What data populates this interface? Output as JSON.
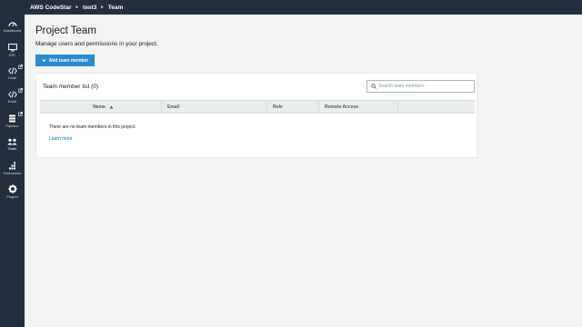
{
  "breadcrumb": {
    "service": "AWS CodeStar",
    "project": "test3",
    "page": "Team"
  },
  "sidebar": {
    "items": [
      {
        "label": "Dashboard",
        "icon": "dashboard-icon"
      },
      {
        "label": "IDE",
        "icon": "monitor-icon"
      },
      {
        "label": "Code",
        "icon": "code-icon"
      },
      {
        "label": "Build",
        "icon": "code-icon"
      },
      {
        "label": "Pipeline",
        "icon": "pipeline-icon"
      },
      {
        "label": "Team",
        "icon": "team-icon"
      },
      {
        "label": "Extensions",
        "icon": "extensions-icon"
      },
      {
        "label": "Project",
        "icon": "gear-icon"
      }
    ]
  },
  "main": {
    "title": "Project Team",
    "subtitle": "Manage users and permissions in your project.",
    "add_button_label": "Add team member"
  },
  "team_panel": {
    "title": "Team member list (0)",
    "search_placeholder": "Search team members",
    "columns": [
      "Name",
      "Email",
      "Role",
      "Remote Access",
      ""
    ],
    "empty_message": "There are no team members in this project.",
    "learn_more": "Learn more"
  }
}
